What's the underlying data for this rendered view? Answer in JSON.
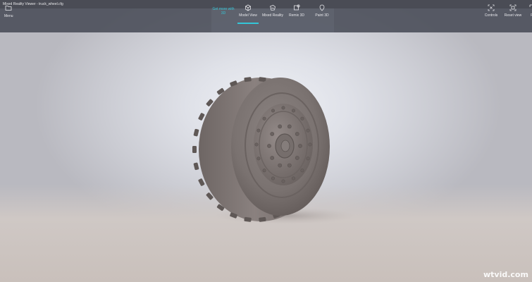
{
  "titlebar": {
    "title": "Mixed Reality Viewer - truck_wheel.cfg"
  },
  "toolbar": {
    "menu": {
      "label": "Menu",
      "icon": "folder-icon"
    },
    "get_more": {
      "label": "Get more with 3D"
    },
    "model_view": {
      "label": "Model View",
      "icon": "cube-icon",
      "selected": true
    },
    "mixed_reality": {
      "label": "Mixed Reality",
      "icon": "mixed-reality-icon"
    },
    "remix_3d": {
      "label": "Remix 3D",
      "icon": "remix-icon"
    },
    "paint_3d": {
      "label": "Paint 3D",
      "icon": "paint-icon"
    },
    "controls": {
      "label": "Controls",
      "icon": "controls-icon"
    },
    "reset_view": {
      "label": "Reset view",
      "icon": "reset-view-icon"
    },
    "fullscreen": {
      "label": "Fu",
      "icon": "fullscreen-icon"
    }
  },
  "colors": {
    "accent": "#34c6d8",
    "toolbar": "#484b56",
    "tire": "#7d7472"
  },
  "watermark": "wtvid.com"
}
